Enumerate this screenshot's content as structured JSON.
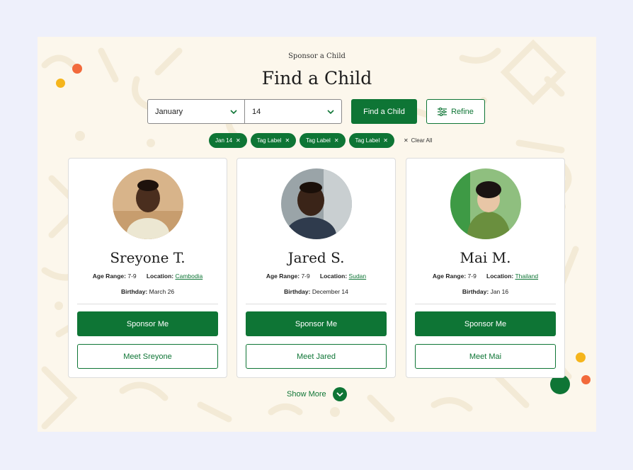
{
  "header": {
    "eyebrow": "Sponsor a Child",
    "title": "Find a Child"
  },
  "search": {
    "month_value": "January",
    "day_value": "14",
    "find_label": "Find a Child",
    "refine_label": "Refine"
  },
  "tags": [
    {
      "label": "Jan 14"
    },
    {
      "label": "Tag Label"
    },
    {
      "label": "Tag Label"
    },
    {
      "label": "Tag Label"
    }
  ],
  "clear_all_label": "Clear All",
  "meta_labels": {
    "age_range": "Age Range:",
    "location": "Location:",
    "birthday": "Birthday:"
  },
  "children": [
    {
      "name": "Sreyone T.",
      "age_range": "7-9",
      "location": "Cambodia",
      "birthday": "March 26",
      "sponsor_label": "Sponsor Me",
      "meet_label": "Meet Sreyone"
    },
    {
      "name": "Jared S.",
      "age_range": "7-9",
      "location": "Sudan",
      "birthday": "December 14",
      "sponsor_label": "Sponsor Me",
      "meet_label": "Meet Jared"
    },
    {
      "name": "Mai M.",
      "age_range": "7-9",
      "location": "Thailand",
      "birthday": "Jan 16",
      "sponsor_label": "Sponsor Me",
      "meet_label": "Meet Mai"
    }
  ],
  "show_more_label": "Show More",
  "colors": {
    "brand_green": "#0e7535",
    "panel_bg": "#fcf7ec",
    "page_bg": "#eef0fb",
    "accent_orange": "#f26a3b",
    "accent_yellow": "#f5b51c"
  }
}
